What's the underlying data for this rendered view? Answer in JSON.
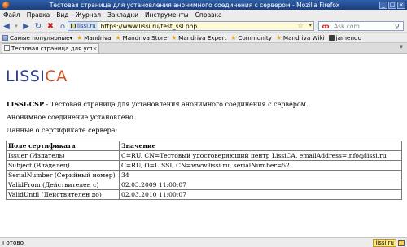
{
  "window": {
    "title": "Тестовая страница для установления анонимного соединения с сервером - Mozilla Firefox"
  },
  "menu": {
    "items": [
      "Файл",
      "Правка",
      "Вид",
      "Журнал",
      "Закладки",
      "Инструменты",
      "Справка"
    ]
  },
  "nav": {
    "site_badge": "lissi.ru",
    "url": "https://www.lissi.ru/test_ssl.php",
    "search_placeholder": "Ask.com"
  },
  "bookmarks": {
    "items": [
      {
        "label": "Самые популярные▾",
        "icon": "sort-icon"
      },
      {
        "label": "Mandriva",
        "icon": "star-icon"
      },
      {
        "label": "Mandriva Store",
        "icon": "star-icon"
      },
      {
        "label": "Mandriva Expert",
        "icon": "star-icon"
      },
      {
        "label": "Community",
        "icon": "star-icon"
      },
      {
        "label": "Mandriva Wiki",
        "icon": "star-icon"
      },
      {
        "label": "jamendo",
        "icon": "jamendo-icon"
      }
    ]
  },
  "tabs": [
    {
      "label": "Тестовая страница для уст..."
    }
  ],
  "page": {
    "logo_main": "LISSI",
    "logo_accent": "CA",
    "heading_bold": "LISSI-CSP",
    "heading_rest": " - Тестовая страница для установления анонимного соединения с сервером.",
    "status_line": "Анонимное соединение установлено.",
    "cert_intro": "Данные о сертификате сервера:",
    "table": {
      "headers": [
        "Поле сертификата",
        "Значение"
      ],
      "rows": [
        [
          "Issuer (Издатель)",
          "C=RU, CN=Тестовый удостоверяющий центр LissiCA, emailAddress=info@lissi.ru"
        ],
        [
          "Subject (Владелец)",
          "C=RU, O=LISSI, CN=www.lissi.ru, serialNumber=52"
        ],
        [
          "SerialNumber (Серийный номер)",
          "34"
        ],
        [
          "ValidFrom (Действителен с)",
          "02.03.2009 11:00:07"
        ],
        [
          "ValidUntil (Действителен до)",
          "02.03.2010 11:00:07"
        ]
      ]
    }
  },
  "status": {
    "text": "Готово",
    "site": "lissi.ru"
  }
}
